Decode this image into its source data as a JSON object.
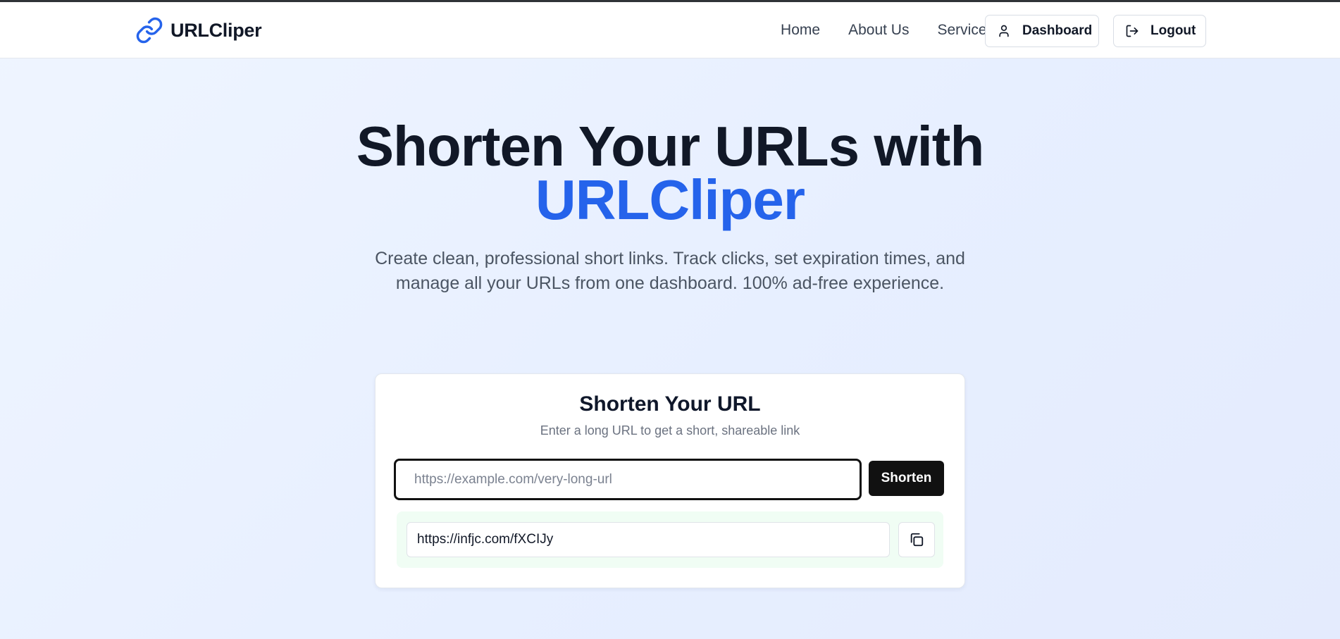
{
  "brand": {
    "name": "URLCliper",
    "icon": "link-icon",
    "accent_color": "#2563eb"
  },
  "nav": {
    "items": [
      {
        "label": "Home"
      },
      {
        "label": "About Us"
      },
      {
        "label": "Services"
      }
    ],
    "dashboard_button": {
      "label": "Dashboard",
      "icon": "user-icon"
    },
    "logout_button": {
      "label": "Logout",
      "icon": "logout-icon"
    }
  },
  "hero": {
    "title_prefix": "Shorten Your URLs with",
    "title_accent": "URLCliper",
    "subtitle": "Create clean, professional short links. Track clicks, set expiration times, and manage all your URLs from one dashboard. 100% ad-free experience."
  },
  "shortener": {
    "title": "Shorten Your URL",
    "subtitle": "Enter a long URL to get a short, shareable link",
    "input_placeholder": "https://example.com/very-long-url",
    "input_value": "",
    "button_label": "Shorten",
    "result_url": "https://infjc.com/fXCIJy",
    "copy_icon": "copy-icon",
    "result_bg_color": "#f0fdf4"
  }
}
